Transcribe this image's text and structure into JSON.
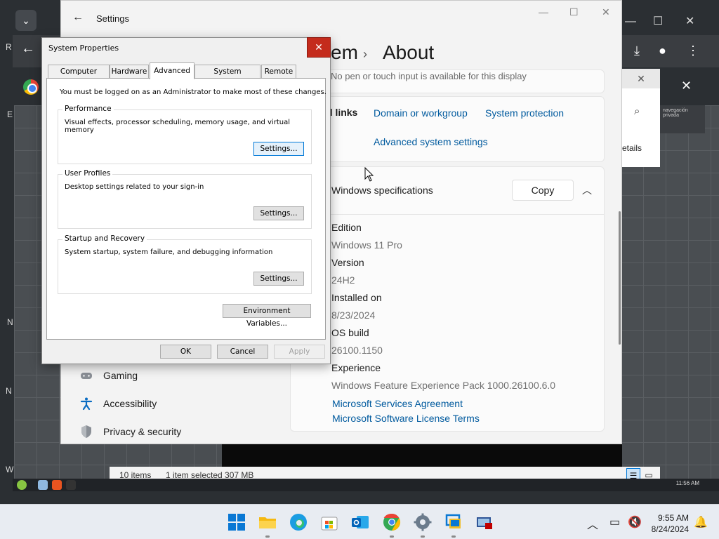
{
  "background": {
    "chevron": "⌄",
    "left_letters": [
      "R",
      "E",
      "N",
      "N",
      "W"
    ],
    "browser_back": "←",
    "toolbar_icons": [
      "download-icon",
      "account-icon",
      "more-icon"
    ],
    "panel_close": "✕",
    "panel_details": "etails",
    "mini_text": "navegación privada",
    "explorer_status": {
      "items": "10 items",
      "selected": "1 item selected  307 MB"
    },
    "vm_clock": "11:56 AM"
  },
  "settings": {
    "window_title": "Settings",
    "breadcrumb_partial": "em",
    "page_title": "About",
    "pen_text": "No pen or touch input is available for this display",
    "related_links_label": "d links",
    "links": [
      "Domain or workgroup",
      "System protection",
      "Advanced system settings"
    ],
    "specs": {
      "title": "Windows specifications",
      "copy_label": "Copy",
      "rows": [
        {
          "label": "Edition",
          "value": "Windows 11 Pro"
        },
        {
          "label": "Version",
          "value": "24H2"
        },
        {
          "label": "Installed on",
          "value": "8/23/2024"
        },
        {
          "label": "OS build",
          "value": "26100.1150"
        },
        {
          "label": "Experience",
          "value": "Windows Feature Experience Pack 1000.26100.6.0"
        }
      ],
      "footer_links": [
        "Microsoft Services Agreement",
        "Microsoft Software License Terms"
      ]
    },
    "nav": [
      {
        "label": "Gaming",
        "icon": "gamepad-icon"
      },
      {
        "label": "Accessibility",
        "icon": "accessibility-icon"
      },
      {
        "label": "Privacy & security",
        "icon": "shield-icon"
      }
    ]
  },
  "system_properties": {
    "title": "System Properties",
    "close": "✕",
    "tabs": [
      "Computer Name",
      "Hardware",
      "Advanced",
      "System Protection",
      "Remote"
    ],
    "active_tab": "Advanced",
    "admin_note": "You must be logged on as an Administrator to make most of these changes.",
    "groups": [
      {
        "title": "Performance",
        "desc": "Visual effects, processor scheduling, memory usage, and virtual memory",
        "button": "Settings..."
      },
      {
        "title": "User Profiles",
        "desc": "Desktop settings related to your sign-in",
        "button": "Settings..."
      },
      {
        "title": "Startup and Recovery",
        "desc": "System startup, system failure, and debugging information",
        "button": "Settings..."
      }
    ],
    "env_button": "Environment Variables...",
    "ok": "OK",
    "cancel": "Cancel",
    "apply": "Apply"
  },
  "taskbar": {
    "time": "9:55 AM",
    "date": "8/24/2024",
    "apps": [
      "start-icon",
      "file-explorer-icon",
      "edge-icon",
      "store-icon",
      "outlook-icon",
      "chrome-icon",
      "settings-icon",
      "remote-desktop-icon",
      "vm-icon"
    ]
  }
}
